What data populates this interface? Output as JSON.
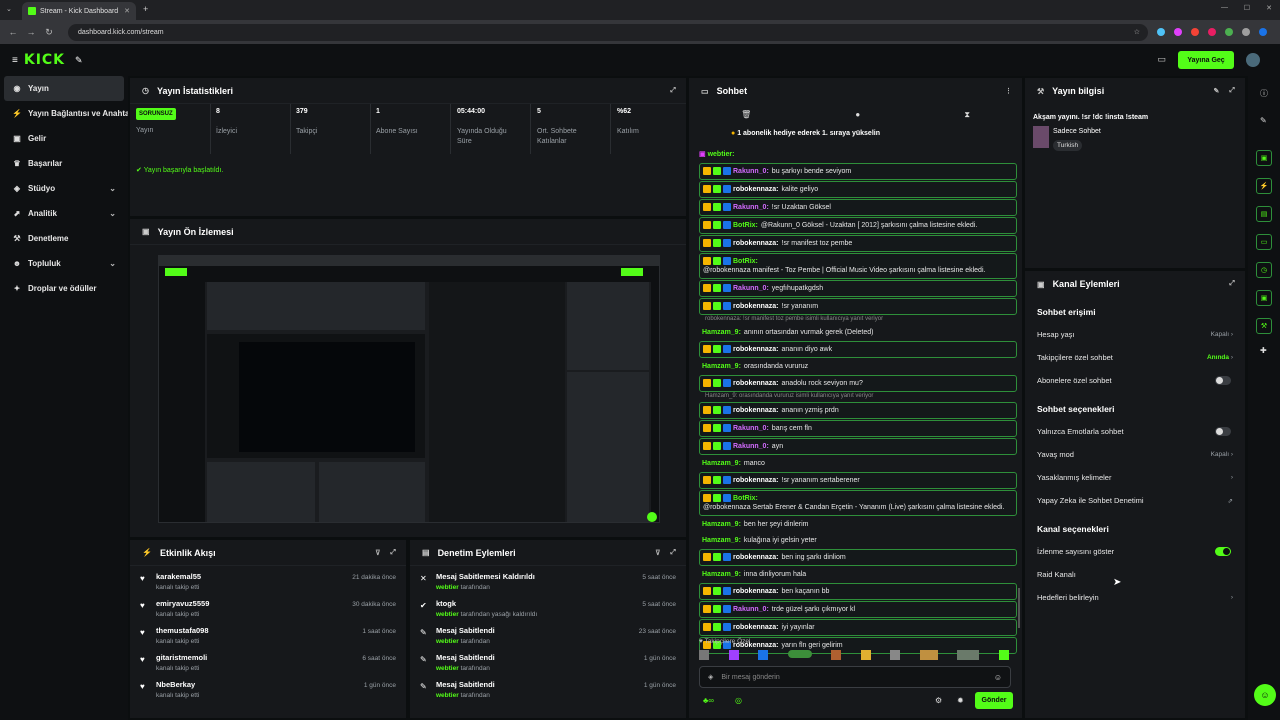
{
  "browser": {
    "tab_title": "Stream - Kick Dashboard",
    "url": "dashboard.kick.com/stream"
  },
  "topbar": {
    "logo": "KICK",
    "go_live": "Yayına Geç"
  },
  "sidebar": {
    "items": [
      {
        "label": "Yayın",
        "icon": "broadcast-icon",
        "chev": ""
      },
      {
        "label": "Yayın Bağlantısı ve Anahtarı",
        "icon": "plug-icon",
        "chev": ""
      },
      {
        "label": "Gelir",
        "icon": "money-icon",
        "chev": ""
      },
      {
        "label": "Başarılar",
        "icon": "trophy-icon",
        "chev": ""
      },
      {
        "label": "Stüdyo",
        "icon": "studio-icon",
        "chev": "⌄"
      },
      {
        "label": "Analitik",
        "icon": "chart-icon",
        "chev": "⌄"
      },
      {
        "label": "Denetleme",
        "icon": "hammer-icon",
        "chev": ""
      },
      {
        "label": "Topluluk",
        "icon": "people-icon",
        "chev": "⌄"
      },
      {
        "label": "Droplar ve ödüller",
        "icon": "gift-icon",
        "chev": ""
      }
    ]
  },
  "stats": {
    "title": "Yayın İstatistikleri",
    "status_badge": "SORUNSUZ",
    "status_label": "Yayın",
    "items": [
      {
        "value": "8",
        "label": "İzleyici"
      },
      {
        "value": "379",
        "label": "Takipçi"
      },
      {
        "value": "1",
        "label": "Abone Sayısı"
      },
      {
        "value": "05:44:00",
        "label": "Yayında Olduğu Süre"
      },
      {
        "value": "5",
        "label": "Ort. Sohbete Katılanlar"
      },
      {
        "value": "%62",
        "label": "Katılım"
      }
    ],
    "success": "Yayın başarıyla başlatıldı."
  },
  "preview": {
    "title": "Yayın Ön İzlemesi"
  },
  "activity": {
    "title": "Etkinlik Akışı",
    "items": [
      {
        "name": "karakemal55",
        "sub": "kanalı takip etti",
        "time": "21 dakika önce"
      },
      {
        "name": "emiryavuz5559",
        "sub": "kanalı takip etti",
        "time": "30 dakika önce"
      },
      {
        "name": "themustafa098",
        "sub": "kanalı takip etti",
        "time": "1 saat önce"
      },
      {
        "name": "gitaristmemoli",
        "sub": "kanalı takip etti",
        "time": "6 saat önce"
      },
      {
        "name": "NbeBerkay",
        "sub": "kanalı takip etti",
        "time": "1 gün önce"
      }
    ]
  },
  "moderation": {
    "title": "Denetim Eylemleri",
    "items": [
      {
        "name": "Mesaj Sabitlemesi Kaldırıldı",
        "user": "webtier",
        "sub": "tarafından",
        "time": "5 saat önce"
      },
      {
        "name": "ktogk",
        "user": "webtier",
        "sub": "tarafından yasağı kaldırıldı",
        "time": "5 saat önce"
      },
      {
        "name": "Mesaj Sabitlendi",
        "user": "webtier",
        "sub": "tarafından",
        "time": "23 saat önce"
      },
      {
        "name": "Mesaj Sabitlendi",
        "user": "webtier",
        "sub": "tarafından",
        "time": "1 gün önce"
      },
      {
        "name": "Mesaj Sabitlendi",
        "user": "webtier",
        "sub": "tarafından",
        "time": "1 gün önce"
      }
    ]
  },
  "chat": {
    "title": "Sohbet",
    "gift_banner": "1 abonelik hediye ederek 1. sıraya yükselin",
    "top_user": "webtier:",
    "messages": [
      {
        "user": "Rakunn_0",
        "color": "#d36bff",
        "text": "bu şarkıyı bende seviyom",
        "box": true
      },
      {
        "user": "robokennaza",
        "color": "#ffffff",
        "text": "kalite geliyo",
        "box": true
      },
      {
        "user": "Rakunn_0",
        "color": "#d36bff",
        "text": "!sr Uzaktan Göksel",
        "box": true
      },
      {
        "user": "BotRix",
        "color": "#53fc18",
        "text": "@Rakunn_0 Göksel - Uzaktan [ 2012] şarkısını çalma listesine ekledi.",
        "box": true
      },
      {
        "user": "robokennaza",
        "color": "#ffffff",
        "text": "!sr manifest toz pembe",
        "box": true
      },
      {
        "user": "BotRix",
        "color": "#53fc18",
        "text": "@robokennaza manifest - Toz Pembe | Official Music Video şarkısını çalma listesine ekledi.",
        "box": true
      },
      {
        "user": "Rakunn_0",
        "color": "#d36bff",
        "text": "yegfıhupatkgdsh",
        "box": true
      },
      {
        "user": "robokennaza",
        "color": "#ffffff",
        "text": "!sr yananım",
        "box": true
      },
      {
        "reply": "robokennaza: !sr manifest toz pembe isimli kullanıcıya yanıt veriyor"
      },
      {
        "user": "Hamzam_9",
        "color": "#53fc18",
        "text": "anının ortasından vurmak gerek (Deleted)",
        "box": false
      },
      {
        "user": "robokennaza",
        "color": "#ffffff",
        "text": "ananın diyo awk",
        "box": true
      },
      {
        "user": "Hamzam_9",
        "color": "#53fc18",
        "text": "orasındanda vururuz",
        "box": false
      },
      {
        "user": "robokennaza",
        "color": "#ffffff",
        "text": "anadolu rock seviyon mu?",
        "box": true
      },
      {
        "reply": "Hamzam_9: orasındanda vururuz isimli kullanıcıya yanıt veriyor"
      },
      {
        "user": "robokennaza",
        "color": "#ffffff",
        "text": "ananın yzmiş prdn",
        "box": true
      },
      {
        "user": "Rakunn_0",
        "color": "#d36bff",
        "text": "barış cem fln",
        "box": true
      },
      {
        "user": "Rakunn_0",
        "color": "#d36bff",
        "text": "ayn",
        "box": true
      },
      {
        "user": "Hamzam_9",
        "color": "#53fc18",
        "text": "manco",
        "box": false
      },
      {
        "user": "robokennaza",
        "color": "#ffffff",
        "text": "!sr yananım sertaberener",
        "box": true
      },
      {
        "user": "BotRix",
        "color": "#53fc18",
        "text": "@robokennaza Sertab Erener & Candan Erçetin - Yananım (Live) şarkısını çalma listesine ekledi.",
        "box": true
      },
      {
        "user": "Hamzam_9",
        "color": "#53fc18",
        "text": "ben her şeyi dinlerim",
        "box": false
      },
      {
        "user": "Hamzam_9",
        "color": "#53fc18",
        "text": "kulağına iyi gelsin yeter",
        "box": false
      },
      {
        "user": "robokennaza",
        "color": "#ffffff",
        "text": "ben ing şarkı dinliom",
        "box": true
      },
      {
        "user": "Hamzam_9",
        "color": "#53fc18",
        "text": "inna dinliyorum hala",
        "box": false
      },
      {
        "user": "robokennaza",
        "color": "#ffffff",
        "text": "ben kaçanın bb",
        "box": true
      },
      {
        "user": "Rakunn_0",
        "color": "#d36bff",
        "text": "trde güzel şarkı çıkmıyor kl",
        "box": true
      },
      {
        "user": "robokennaza",
        "color": "#ffffff",
        "text": "iyi yayınlar",
        "box": true
      },
      {
        "user": "robokennaza",
        "color": "#ffffff",
        "text": "yarın fln geri gelirim",
        "box": true
      }
    ],
    "followers_only": "Takipçilere Özel",
    "input_placeholder": "Bir mesaj gönderin",
    "send": "Gönder"
  },
  "stream_info": {
    "title": "Yayın bilgisi",
    "stream_title": "Akşam yayını. !sr !dc !insta !steam",
    "category": "Sadece Sohbet",
    "tag": "Turkish"
  },
  "channel_actions": {
    "title": "Kanal Eylemleri",
    "chat_access": "Sohbet erişimi",
    "account_age": "Hesap yaşı",
    "account_age_val": "Kapalı",
    "followers_chat": "Takipçilere özel sohbet",
    "followers_chat_val": "Anında",
    "subs_chat": "Abonelere özel sohbet",
    "chat_options": "Sohbet seçenekleri",
    "emotes_only": "Yalnızca Emotlarla sohbet",
    "slow_mode": "Yavaş mod",
    "slow_mode_val": "Kapalı",
    "banned_words": "Yasaklanmış kelimeler",
    "ai_moderation": "Yapay Zeka ile Sohbet Denetimi",
    "channel_options": "Kanal seçenekleri",
    "show_viewers": "İzlenme sayısını göster",
    "raid": "Raid Kanalı",
    "goals": "Hedefleri belirleyin"
  }
}
